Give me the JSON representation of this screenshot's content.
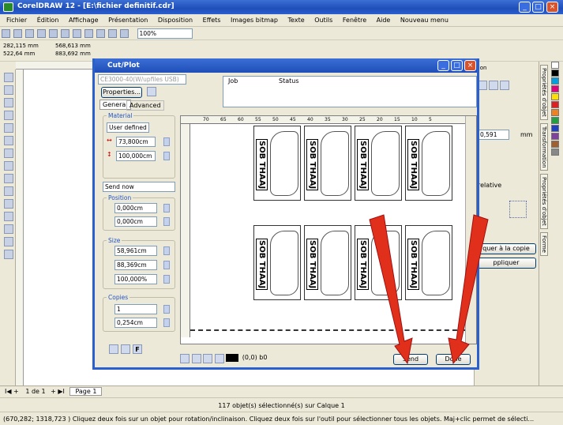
{
  "app": {
    "title": "CorelDRAW 12 - [E:\\fichier definitif.cdr]"
  },
  "menu": [
    "Fichier",
    "Édition",
    "Affichage",
    "Présentation",
    "Disposition",
    "Effets",
    "Images bitmap",
    "Texte",
    "Outils",
    "Fenêtre",
    "Aide",
    "Nouveau menu"
  ],
  "toolbar": {
    "zoom": "100%"
  },
  "propbar": {
    "x": "282,115 mm",
    "y": "522,64 mm",
    "w": "568,613 mm",
    "h": "883,692 mm"
  },
  "dialog": {
    "title": "Cut/Plot",
    "device": "CE3000-40(W/upfiles USB)",
    "properties_label": "Properties...",
    "tabs": [
      "General",
      "Advanced"
    ],
    "job_col": "Job",
    "status_col": "Status",
    "material_label": "Material",
    "material_value": "User defined",
    "width_value": "73,800cm",
    "height_value": "100,000cm",
    "send_mode": "Send now",
    "position_label": "Position",
    "pos_x": "0,000cm",
    "pos_y": "0,000cm",
    "size_label": "Size",
    "size_w": "58,961cm",
    "size_h": "88,369cm",
    "scale": "100,000%",
    "copies_label": "Copies",
    "copies": "1",
    "spacing": "0,254cm",
    "coord": "(0,0) b0",
    "send_label": "Send",
    "done_label": "Done",
    "ruler_ticks": [
      "70",
      "65",
      "60",
      "55",
      "50",
      "45",
      "40",
      "35",
      "30",
      "25",
      "20",
      "15",
      "10",
      "5"
    ],
    "tile_text": "SOB THAAJ"
  },
  "rightpanel": {
    "unit": "mm",
    "value": "0,591",
    "relative": "relative",
    "apply_copy": "quer à la copie",
    "apply": "ppliquer",
    "header": "tion"
  },
  "dockers": [
    "Propriétés d'objet",
    "Transformation",
    "Propriétés d'objet",
    "Forme"
  ],
  "pagenav": {
    "pos": "1 de 1",
    "page_tab": "Page 1"
  },
  "status": {
    "line1": "117 objet(s) sélectionné(s) sur Calque 1",
    "line2": "(670,282; 1318,723 ) Cliquez deux fois sur un objet pour rotation/inclinaison. Cliquez deux fois sur l'outil pour sélectionner tous les objets. Maj+clic permet de sélecti..."
  },
  "colors": {
    "titlebar": "#2a5fd0",
    "arrow": "#e0301c"
  }
}
